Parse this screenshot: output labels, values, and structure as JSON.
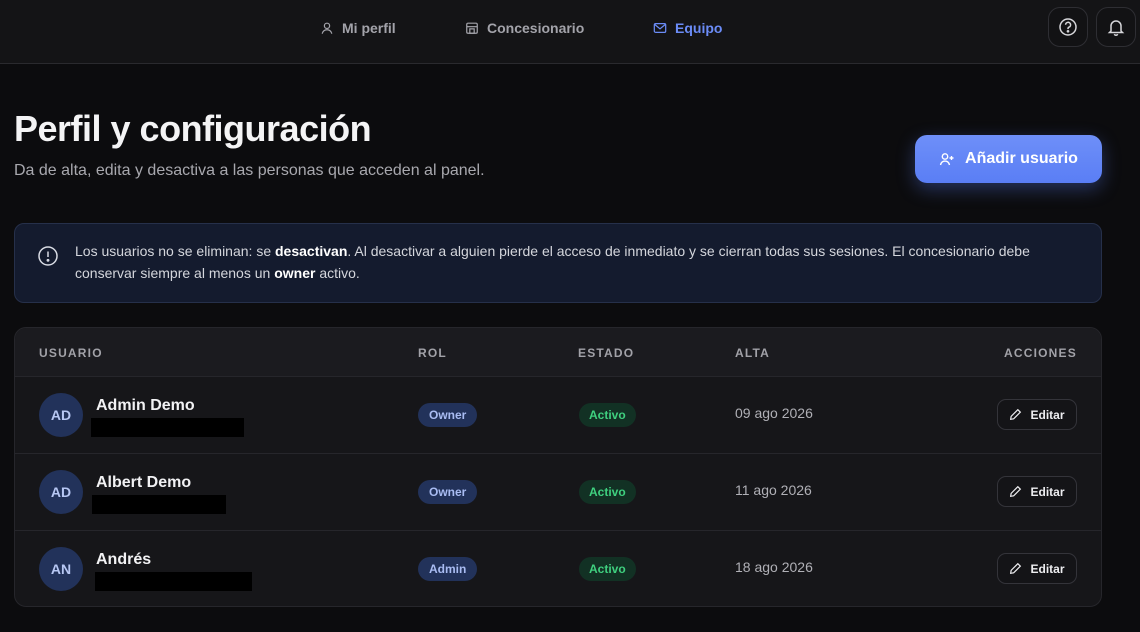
{
  "nav": {
    "items": [
      {
        "label": "Mi perfil",
        "icon": "user-icon",
        "active": false
      },
      {
        "label": "Concesionario",
        "icon": "store-icon",
        "active": false
      },
      {
        "label": "Equipo",
        "icon": "mail-icon",
        "active": true
      }
    ],
    "help_icon": "help-icon",
    "bell_icon": "bell-icon"
  },
  "header": {
    "title": "Perfil y configuración",
    "subtitle": "Da de alta, edita y desactiva a las personas que acceden al panel.",
    "add_button_label": "Añadir usuario"
  },
  "info": {
    "part1": "Los usuarios no se eliminan: se ",
    "bold1": "desactivan",
    "part2": ". Al desactivar a alguien pierde el acceso de inmediato y se cierran todas sus sesiones. El concesionario debe conservar siempre al menos un ",
    "bold2": "owner",
    "part3": " activo."
  },
  "table": {
    "headers": {
      "user": "USUARIO",
      "role": "ROL",
      "status": "ESTADO",
      "date": "ALTA",
      "actions": "ACCIONES"
    },
    "rows": [
      {
        "initials": "AD",
        "name": "Admin Demo",
        "role": "Owner",
        "status": "Activo",
        "date": "09 ago 2026",
        "action": "Editar"
      },
      {
        "initials": "AD",
        "name": "Albert Demo",
        "role": "Owner",
        "status": "Activo",
        "date": "11 ago 2026",
        "action": "Editar"
      },
      {
        "initials": "AN",
        "name": "Andrés",
        "role": "Admin",
        "status": "Activo",
        "date": "18 ago 2026",
        "action": "Editar"
      }
    ]
  },
  "colors": {
    "accent": "#6b8cf7",
    "background": "#0c0c0e",
    "status_active": "#3fd07f",
    "role_badge_bg": "#22325a"
  }
}
